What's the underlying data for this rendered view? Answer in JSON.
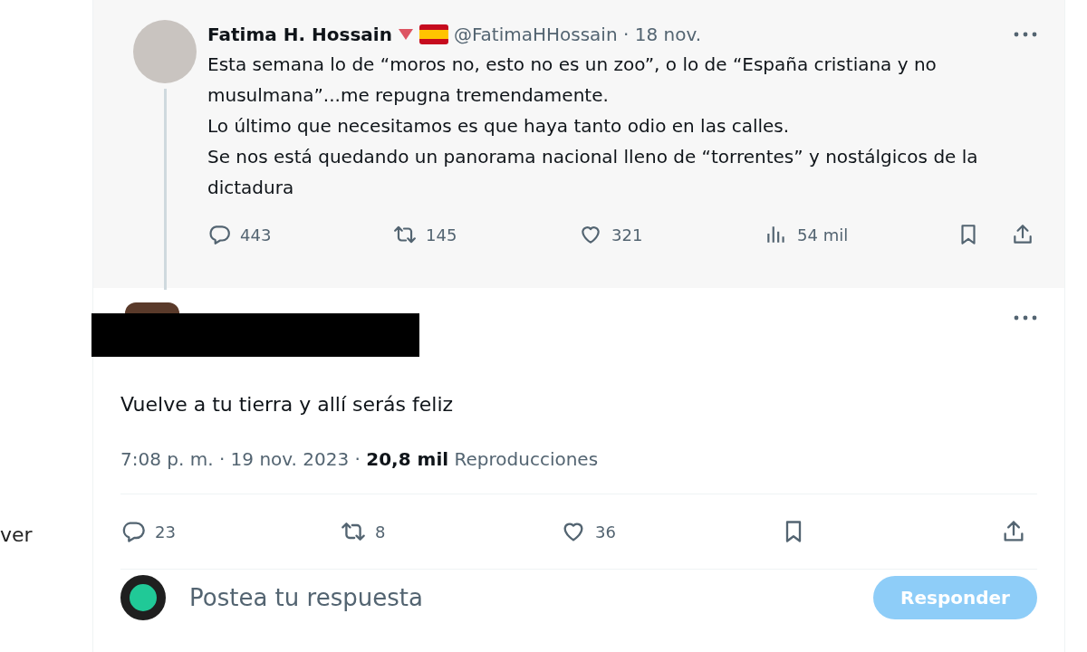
{
  "side_fragment": {
    "text": "ver"
  },
  "quoted_post": {
    "author": "Fatima H. Hossain",
    "meta": "@FatimaHHossain · 18 nov.",
    "lines": [
      "Esta semana lo de “moros no, esto no es un zoo”, o lo de “España cristiana y no musulmana”...me repugna tremendamente.",
      "Lo último que necesitamos es que haya tanto odio en las calles.",
      "Se nos está quedando un panorama  nacional lleno de “torrentes” y nostálgicos de la dictadura"
    ],
    "stats": [
      {
        "kind": "reply",
        "count": "443"
      },
      {
        "kind": "repost",
        "count": "145"
      },
      {
        "kind": "like",
        "count": "321"
      },
      {
        "kind": "views",
        "count": "54 mil"
      },
      {
        "kind": "bookmark"
      },
      {
        "kind": "share"
      }
    ]
  },
  "main_post": {
    "text": "Vuelve a tu tierra y allí serás feliz",
    "meta": "7:08 p. m. · 19 nov. 2023 · **20,8 mil** Reproducciones",
    "stats": [
      {
        "kind": "reply",
        "count": "23"
      },
      {
        "kind": "repost",
        "count": "8"
      },
      {
        "kind": "like",
        "count": "36"
      },
      {
        "kind": "bookmark"
      },
      {
        "kind": "share"
      }
    ]
  },
  "reply_box": {
    "placeholder": "Postea tu respuesta",
    "button": {
      "label": "Responder",
      "disabled": true
    }
  }
}
